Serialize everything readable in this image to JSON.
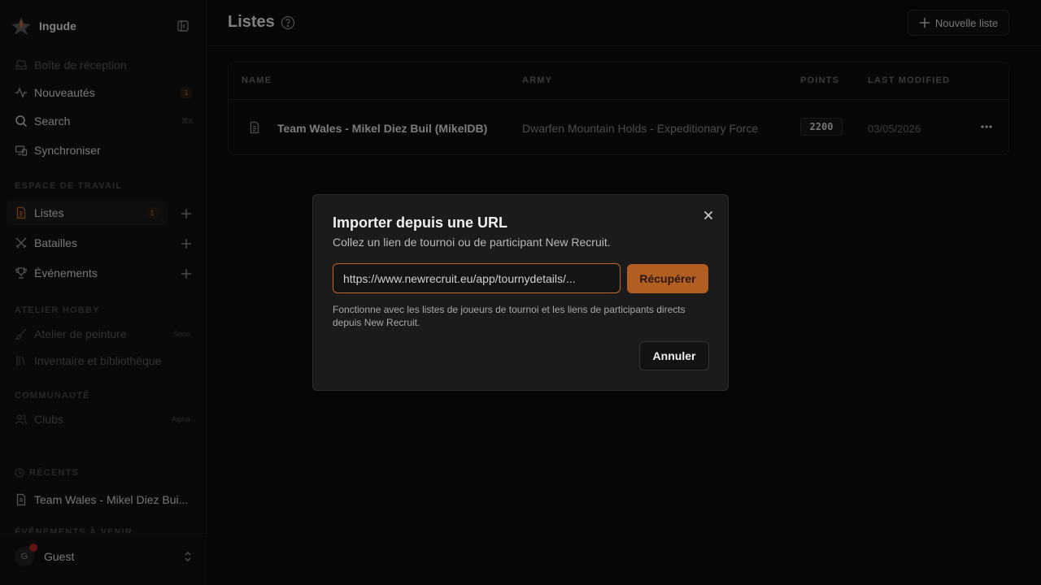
{
  "app": {
    "name": "Ingude"
  },
  "sidebar": {
    "top_items": [
      {
        "label": "Boîte de réception",
        "icon": "inbox-icon",
        "dim": true
      },
      {
        "label": "Nouveautés",
        "icon": "activity-icon",
        "badge": "1"
      },
      {
        "label": "Search",
        "icon": "search-icon",
        "shortcut": "⌘K"
      },
      {
        "label": "Synchroniser",
        "icon": "devices-icon"
      }
    ],
    "workspace": {
      "label": "ESPACE DE TRAVAIL",
      "items": [
        {
          "label": "Listes",
          "icon": "file-icon",
          "badge": "1",
          "active": true
        },
        {
          "label": "Batailles",
          "icon": "swords-icon"
        },
        {
          "label": "Événements",
          "icon": "trophy-icon"
        }
      ]
    },
    "hobby": {
      "label": "ATELIER HOBBY",
      "items": [
        {
          "label": "Atelier de peinture",
          "icon": "brush-icon",
          "tag": "Soon"
        },
        {
          "label": "Inventaire et bibliothèque",
          "icon": "library-icon"
        }
      ]
    },
    "community": {
      "label": "COMMUNAUTÉ",
      "items": [
        {
          "label": "Clubs",
          "icon": "users-icon",
          "tag": "Alpha"
        }
      ]
    },
    "recents": {
      "label": "RÉCENTS",
      "items": [
        {
          "label": "Team Wales - Mikel Diez Bui..."
        }
      ]
    },
    "upcoming_label": "ÉVÉNEMENTS À VENIR",
    "user": {
      "initial": "G",
      "name": "Guest"
    }
  },
  "header": {
    "title": "Listes",
    "new_button": "Nouvelle liste"
  },
  "table": {
    "columns": [
      "NAME",
      "ARMY",
      "POINTS",
      "LAST MODIFIED"
    ],
    "rows": [
      {
        "name": "Team Wales - Mikel Diez Buil (MikelDB)",
        "army": "Dwarfen Mountain Holds - Expeditionary Force",
        "points": "2200",
        "modified": "03/05/2026"
      }
    ]
  },
  "dialog": {
    "title": "Importer depuis une URL",
    "description": "Collez un lien de tournoi ou de participant New Recruit.",
    "input_value": "https://www.newrecruit.eu/app/tournydetails/...",
    "fetch_button": "Récupérer",
    "help": "Fonctionne avec les listes de joueurs de tournoi et les liens de participants directs depuis New Recruit.",
    "cancel_button": "Annuler"
  },
  "colors": {
    "accent": "#b35f24",
    "accent_text": "#c2672a",
    "background": "#0b0b0b",
    "dialog": "#1b1b1b"
  }
}
